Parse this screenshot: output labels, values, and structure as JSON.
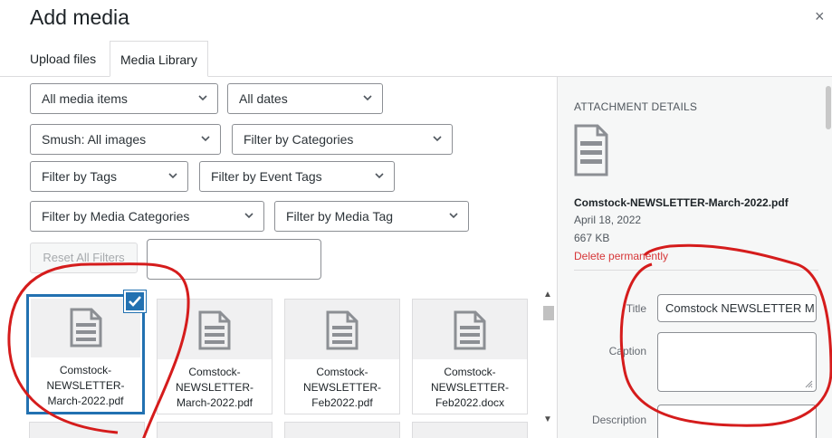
{
  "modal": {
    "title": "Add media",
    "close_icon": "×"
  },
  "tabs": [
    {
      "label": "Upload files",
      "active": false
    },
    {
      "label": "Media Library",
      "active": true
    }
  ],
  "filters": {
    "media_items": "All media items",
    "dates": "All dates",
    "smush": "Smush: All images",
    "categories": "Filter by Categories",
    "tags": "Filter by Tags",
    "event_tags": "Filter by Event Tags",
    "media_categories": "Filter by Media Categories",
    "media_tag": "Filter by Media Tag",
    "reset_label": "Reset All Filters",
    "search_value": ""
  },
  "attachments": [
    {
      "name": "Comstock-NEWSLETTER-March-2022.pdf",
      "line1": "Comstock-",
      "line2": "NEWSLETTER-",
      "line3": "March-2022.pdf",
      "selected": true
    },
    {
      "name": "Comstock-NEWSLETTER-March-2022.pdf",
      "line1": "Comstock-",
      "line2": "NEWSLETTER-",
      "line3": "March-2022.pdf",
      "selected": false
    },
    {
      "name": "Comstock-NEWSLETTER-Feb2022.pdf",
      "line1": "Comstock-",
      "line2": "NEWSLETTER-",
      "line3": "Feb2022.pdf",
      "selected": false
    },
    {
      "name": "Comstock-NEWSLETTER-Feb2022.docx",
      "line1": "Comstock-",
      "line2": "NEWSLETTER-",
      "line3": "Feb2022.docx",
      "selected": false
    }
  ],
  "details": {
    "heading": "ATTACHMENT DETAILS",
    "filename": "Comstock-NEWSLETTER-March-2022.pdf",
    "date": "April 18, 2022",
    "size": "667 KB",
    "delete_label": "Delete permanently",
    "title_label": "Title",
    "title_value": "Comstock NEWSLETTER M",
    "caption_label": "Caption",
    "caption_value": "",
    "description_label": "Description",
    "description_value": ""
  },
  "colors": {
    "accent": "#2271b1",
    "danger": "#d63638",
    "annotation": "#d51c1c"
  }
}
